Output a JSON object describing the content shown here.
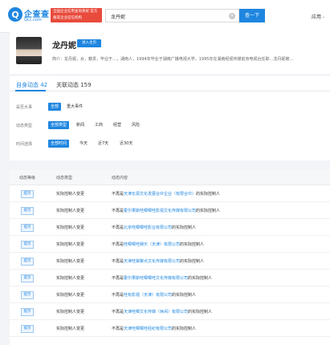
{
  "header": {
    "logo_mark": "Q",
    "logo_cn": "企查查",
    "logo_domain": "Qcc.com",
    "badge_text": "全国企业信用查询系统 官方备案企业征信机构",
    "search_value": "龙丹妮",
    "search_button": "查一下",
    "nav_apply": "应用 -"
  },
  "profile": {
    "name": "龙丹妮",
    "enter_button": "进入主页",
    "intro": "简介：龙丹妮，女，籍贯，毕业于…，湖南人，1994年毕业于湖南广播电视大学，1995年在湖南经视传媒前身电视台任职…龙丹妮被…"
  },
  "tabs": [
    {
      "label": "自身动态 42"
    },
    {
      "label": "关联动态 159"
    }
  ],
  "filters": [
    {
      "label": "是否大事",
      "options": [
        "全部",
        "重大事件"
      ],
      "selected": 0
    },
    {
      "label": "动态类型",
      "options": [
        "全部类型",
        "新闻",
        "工商",
        "经营",
        "风险"
      ],
      "selected": 0
    },
    {
      "label": "时间选择",
      "options": [
        "全部时间",
        "今天",
        "近7天",
        "近30天"
      ],
      "selected": 0
    }
  ],
  "table": {
    "headers": [
      "动态等级",
      "动态类型",
      "动态内容"
    ],
    "rows": [
      {
        "level": "提示",
        "type": "实际控制人变更",
        "prefix": "不再是",
        "company": "天津长源文化发展合伙企业（有限合伙）",
        "suffix": "的实际控制人"
      },
      {
        "level": "提示",
        "type": "实际控制人变更",
        "prefix": "不再是",
        "company": "霍尔果斯哇唧唧哇影视文化传媒有限公司",
        "suffix": "的实际控制人"
      },
      {
        "level": "提示",
        "type": "实际控制人变更",
        "prefix": "不再是",
        "company": "北京哇唧唧哇影业有限公司",
        "suffix": "的实际控制人"
      },
      {
        "level": "提示",
        "type": "实际控制人变更",
        "prefix": "不再是",
        "company": "哇唧唧哇娱乐（天津）有限公司",
        "suffix": "的实际控制人"
      },
      {
        "level": "提示",
        "type": "实际控制人变更",
        "prefix": "不再是",
        "company": "天津哇棠聚点文化传媒有限公司",
        "suffix": "的实际控制人"
      },
      {
        "level": "提示",
        "type": "实际控制人变更",
        "prefix": "不再是",
        "company": "霍尔果斯哇唧唧哇文化传媒有限公司",
        "suffix": "的实际控制人"
      },
      {
        "level": "提示",
        "type": "实际控制人变更",
        "prefix": "不再是",
        "company": "哇有影视（天津）有限公司",
        "suffix": "的实际控制人"
      },
      {
        "level": "提示",
        "type": "实际控制人变更",
        "prefix": "不再是",
        "company": "天津哇唧文化传媒（休闲）有限公司",
        "suffix": "的实际控制人"
      },
      {
        "level": "提示",
        "type": "实际控制人变更",
        "prefix": "不再是",
        "company": "天津哇唧唧哇经纪有限公司",
        "suffix": "的实际控制人"
      }
    ]
  },
  "colors": {
    "accent": "#1f86e0",
    "badge": "#e84b3c"
  }
}
